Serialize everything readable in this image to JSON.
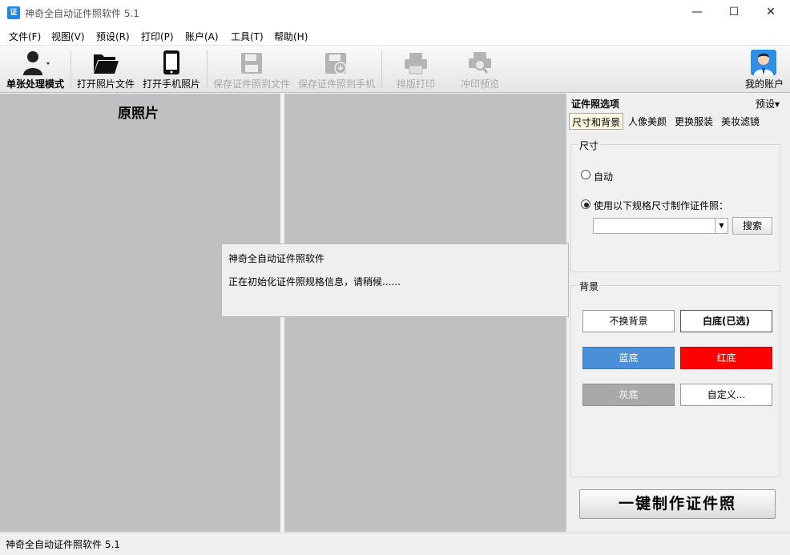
{
  "window": {
    "app_icon": "证",
    "title": "神奇全自动证件照软件 5.1",
    "controls": {
      "minimize": "—",
      "maximize": "☐",
      "close": "✕"
    }
  },
  "menu": [
    "文件(F)",
    "视图(V)",
    "预设(R)",
    "打印(P)",
    "账户(A)",
    "工具(T)",
    "帮助(H)"
  ],
  "toolbar": {
    "single_mode": "单张处理模式",
    "open_photo": "打开照片文件",
    "open_phone": "打开手机照片",
    "save_file": "保存证件照到文件",
    "save_phone": "保存证件照到手机",
    "layout_print": "排版打印",
    "print_preview": "冲印预览",
    "my_account": "我的账户"
  },
  "workspace": {
    "original_title": "原照片"
  },
  "right_panel": {
    "title": "证件照选项",
    "preset": "预设▾",
    "tabs": [
      "尺寸和背景",
      "人像美颜",
      "更换服装",
      "美妆滤镜"
    ],
    "active_tab": 0,
    "size_group": {
      "label": "尺寸",
      "auto_option": "自动",
      "custom_option": "使用以下规格尺寸制作证件照：",
      "selected": "custom",
      "select_value": "",
      "search_button": "搜索"
    },
    "background_group": {
      "label": "背景",
      "buttons": [
        {
          "label": "不换背景",
          "color": "#ffffff",
          "text_color": "#000000",
          "bold": false
        },
        {
          "label": "白底(已选)",
          "color": "#ffffff",
          "text_color": "#000000",
          "bold": true
        },
        {
          "label": "蓝底",
          "color": "#4a90d9",
          "text_color": "#ffffff",
          "bold": false
        },
        {
          "label": "红底",
          "color": "#ff0000",
          "text_color": "#ffffff",
          "bold": false
        },
        {
          "label": "灰底",
          "color": "#a9a9a9",
          "text_color": "#ffffff",
          "bold": false
        },
        {
          "label": "自定义...",
          "color": "#ffffff",
          "text_color": "#000000",
          "bold": false
        }
      ]
    },
    "make_button": "一键制作证件照"
  },
  "dialog": {
    "title": "神奇全自动证件照软件",
    "message": "正在初始化证件照规格信息，请稍候......"
  },
  "status": {
    "text": "神奇全自动证件照软件 5.1"
  }
}
